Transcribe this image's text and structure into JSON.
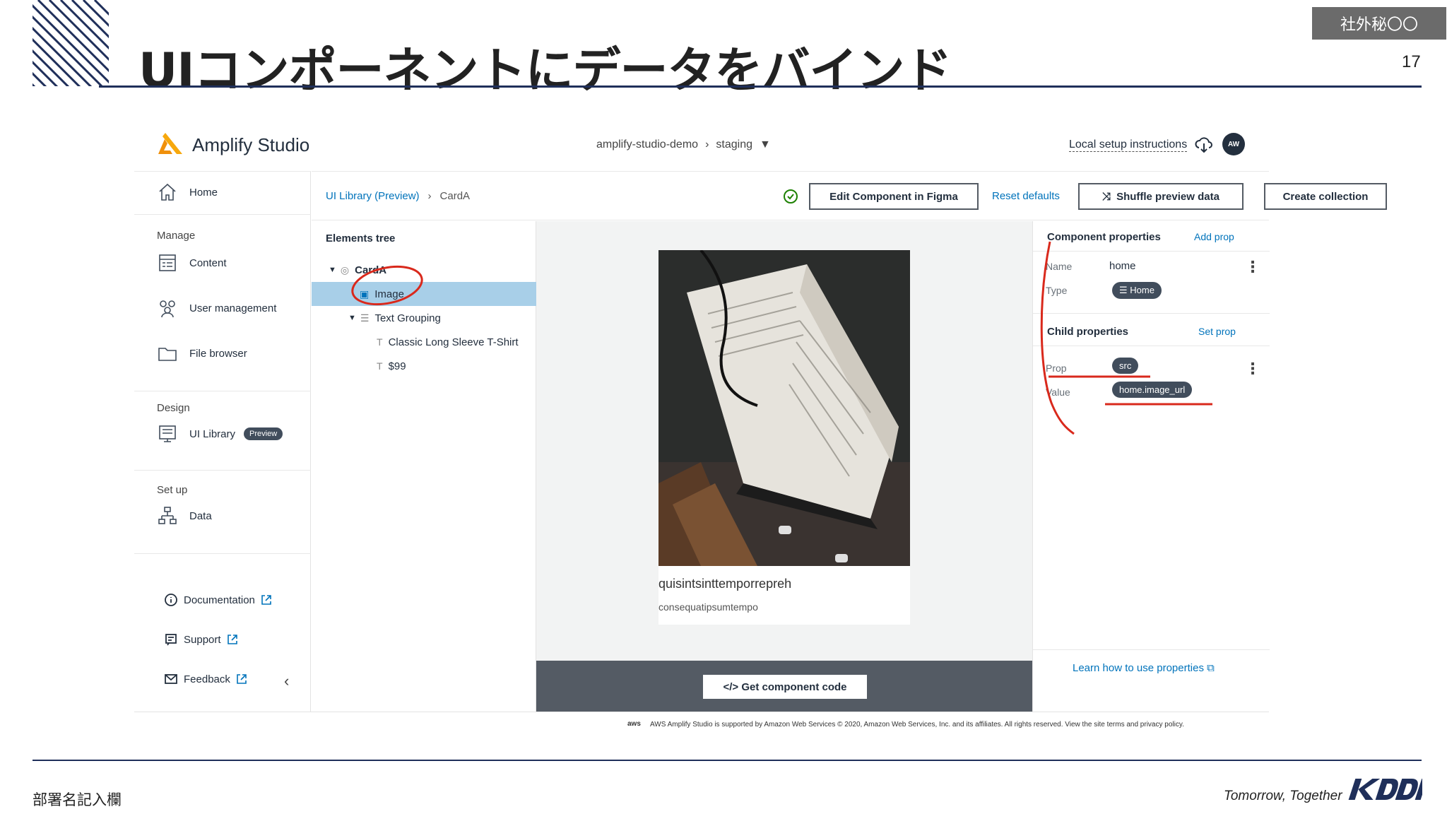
{
  "slide": {
    "title": "UIコンポーネントにデータをバインド",
    "confidential": "社外秘〇〇",
    "page_number": "17",
    "department": "部署名記入欄",
    "tagline": "Tomorrow, Together",
    "brand": "KDDI"
  },
  "app": {
    "name": "Amplify Studio",
    "env": {
      "project": "amplify-studio-demo",
      "branch": "staging"
    },
    "local_setup": "Local setup instructions",
    "avatar": "AW",
    "sidebar": {
      "home": "Home",
      "manage_label": "Manage",
      "content": "Content",
      "user_management": "User management",
      "file_browser": "File browser",
      "design_label": "Design",
      "ui_library": "UI Library",
      "preview_badge": "Preview",
      "setup_label": "Set up",
      "data": "Data",
      "documentation": "Documentation",
      "support": "Support",
      "feedback": "Feedback"
    },
    "toolbar": {
      "breadcrumb_root": "UI Library (Preview)",
      "breadcrumb_current": "CardA",
      "edit_figma": "Edit Component in Figma",
      "reset_defaults": "Reset defaults",
      "shuffle": "Shuffle preview data",
      "create_collection": "Create collection"
    },
    "tree": {
      "heading": "Elements tree",
      "items": [
        "CardA",
        "Image",
        "Text Grouping",
        "Classic Long Sleeve T-Shirt",
        "$99"
      ]
    },
    "preview": {
      "title": "quisintsinttemporrepreh",
      "subtitle": "consequatipsumtempo",
      "code_button": "</> Get component code"
    },
    "props": {
      "component_heading": "Component properties",
      "add_prop": "Add prop",
      "name_label": "Name",
      "name_value": "home",
      "type_label": "Type",
      "type_value": "Home",
      "child_heading": "Child properties",
      "set_prop": "Set prop",
      "prop_label": "Prop",
      "prop_value": "src",
      "value_label": "Value",
      "value_value": "home.image_url",
      "learn_link": "Learn how to use properties"
    },
    "footer": {
      "aws": "aws",
      "copyright": "AWS Amplify Studio is supported by Amazon Web Services © 2020, Amazon Web Services, Inc. and its affiliates. All rights reserved. View the site terms and privacy policy."
    }
  },
  "colors": {
    "navy": "#1f2f5a",
    "annotation_red": "#d9291c",
    "aws_link": "#0073bb",
    "selection": "#a8cfe8"
  }
}
